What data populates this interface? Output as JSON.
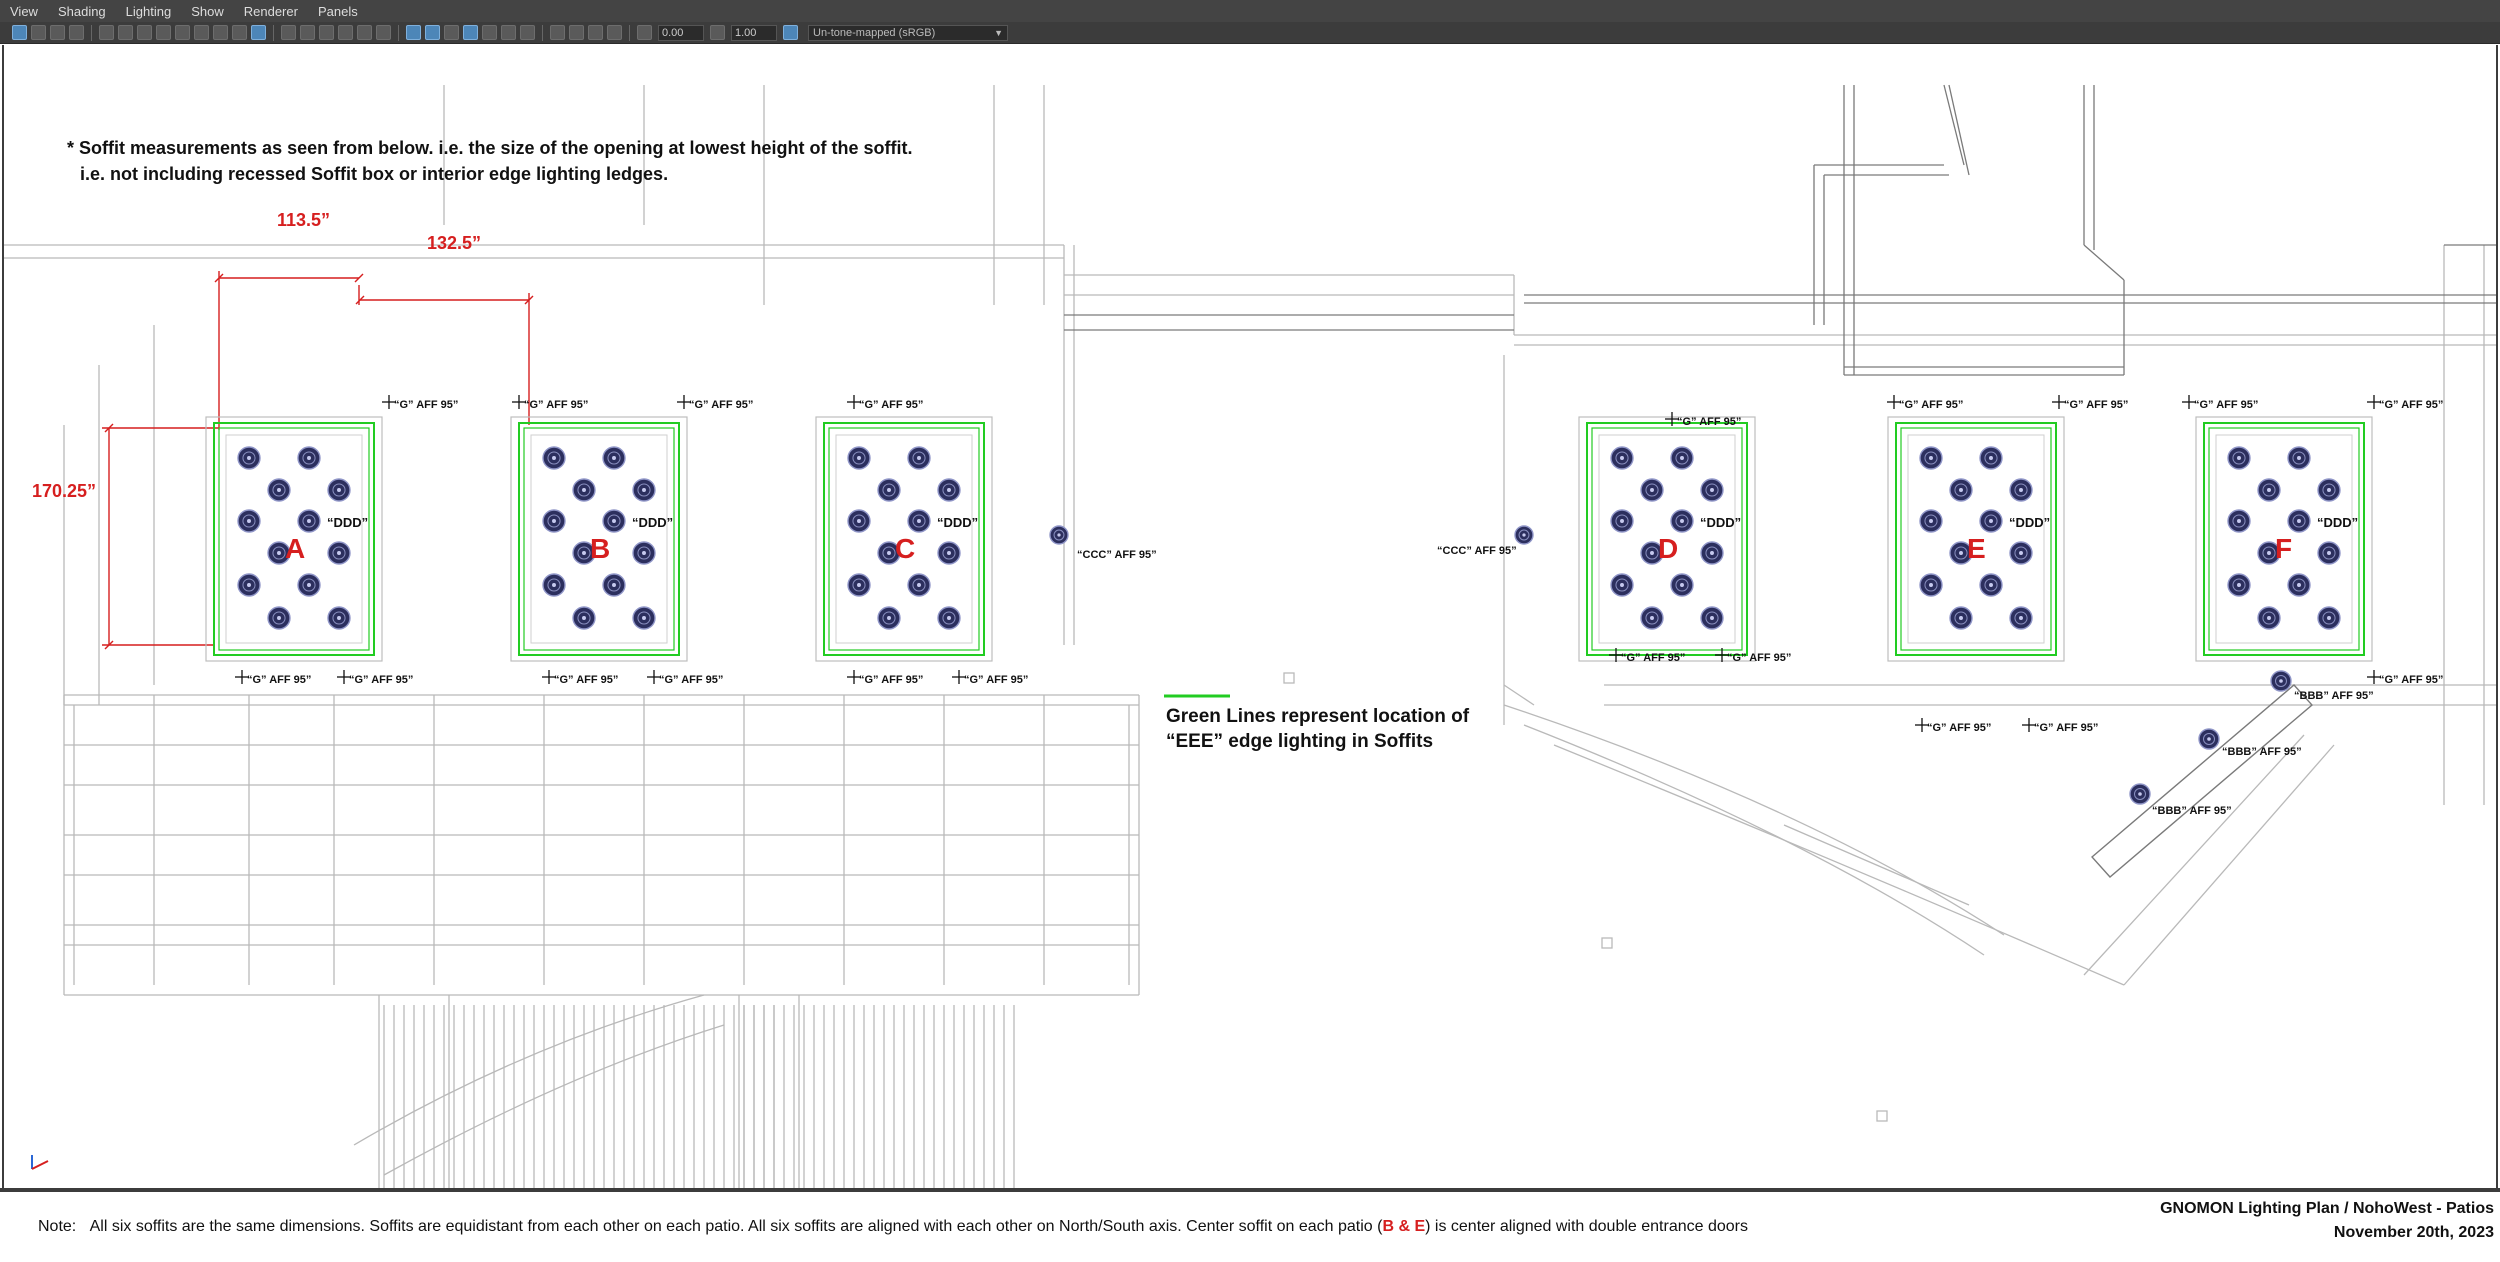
{
  "menus": [
    "View",
    "Shading",
    "Lighting",
    "Show",
    "Renderer",
    "Panels"
  ],
  "toolbar": {
    "exposure": "0.00",
    "gamma": "1.00",
    "colorspace": "Un-tone-mapped (sRGB)"
  },
  "header_note": {
    "line1": "* Soffit measurements as seen from below. i.e. the size of the opening at lowest height of the soffit.",
    "line2": "i.e. not including recessed Soffit box or interior edge lighting ledges."
  },
  "dims": {
    "width_a": "113.5”",
    "spacing": "132.5”",
    "height": "170.25”"
  },
  "soffits": [
    {
      "letter": "A",
      "ddd": "“DDD”"
    },
    {
      "letter": "B",
      "ddd": "“DDD”"
    },
    {
      "letter": "C",
      "ddd": "“DDD”"
    },
    {
      "letter": "D",
      "ddd": "“DDD”"
    },
    {
      "letter": "E",
      "ddd": "“DDD”"
    },
    {
      "letter": "F",
      "ddd": "“DDD”"
    }
  ],
  "fixture_labels": {
    "g": "“G” AFF 95”",
    "ccc": "“CCC” AFF 95”",
    "bbb": "“BBB” AFF 95”"
  },
  "legend": {
    "line1": "Green Lines represent location of",
    "line2": "“EEE” edge lighting in Soffits",
    "color": "#22cc22"
  },
  "colors": {
    "accent_red": "#d61f1f",
    "fixture": "#2c2f5e",
    "soffit_edge": "#22cc22"
  },
  "footer": {
    "note_label": "Note:",
    "note_text_1": "All six soffits are the same dimensions. Soffits are equidistant from each other on each patio.   All six soffits are aligned with each other on North/South axis. Center soffit on each patio (",
    "note_red": "B & E",
    "note_text_2": ") is center aligned with double entrance doors",
    "title": "GNOMON Lighting Plan / NohoWest - Patios",
    "date": "November 20th, 2023"
  }
}
